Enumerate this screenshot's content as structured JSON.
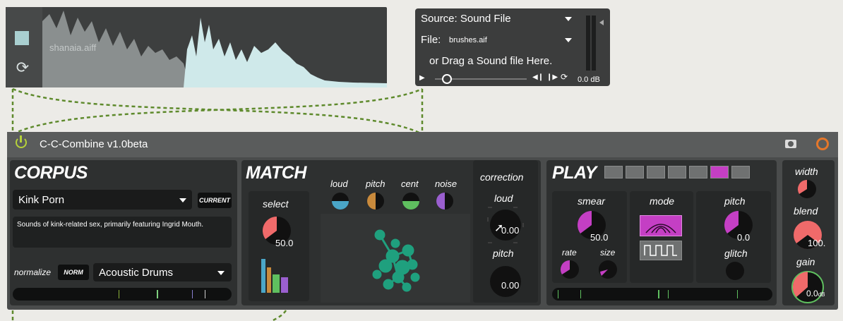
{
  "waveform": {
    "filename": "shanaia.aiff"
  },
  "soundfile": {
    "source_label": "Source: Sound File",
    "file_label": "File:",
    "file_name": "brushes.aif",
    "drag_text": "or Drag a Sound file Here.",
    "level": "0.0 dB"
  },
  "device": {
    "title": "C-C-Combine v1.0beta",
    "corpus": {
      "heading": "CORPUS",
      "selected": "Kink Porn",
      "current_button": "CURRENT",
      "description": "Sounds of kink-related sex, primarily featuring Ingrid Mouth.",
      "normalize_label": "normalize",
      "norm_button": "NORM",
      "norm_corpus": "Acoustic Drums"
    },
    "match": {
      "heading": "MATCH",
      "select_label": "select",
      "select_value": "50.0",
      "descriptors": [
        "loud",
        "pitch",
        "cent",
        "noise"
      ],
      "correction_label": "correction",
      "loud_label": "loud",
      "loud_value": "0.00",
      "pitch_label": "pitch",
      "pitch_value": "0.00"
    },
    "play": {
      "heading": "PLAY",
      "smear_label": "smear",
      "smear_value": "50.0",
      "rate_label": "rate",
      "size_label": "size",
      "mode_label": "mode",
      "pitch_label": "pitch",
      "pitch_value": "0.0",
      "glitch_label": "glitch"
    },
    "output": {
      "width_label": "width",
      "blend_label": "blend",
      "blend_value": "100.",
      "gain_label": "gain",
      "gain_value": "0.0",
      "gain_unit": "dB"
    }
  },
  "colors": {
    "accent_magenta": "#c43fc4",
    "knob_red": "#f06a6a",
    "cluster_green": "#1fa07e"
  }
}
